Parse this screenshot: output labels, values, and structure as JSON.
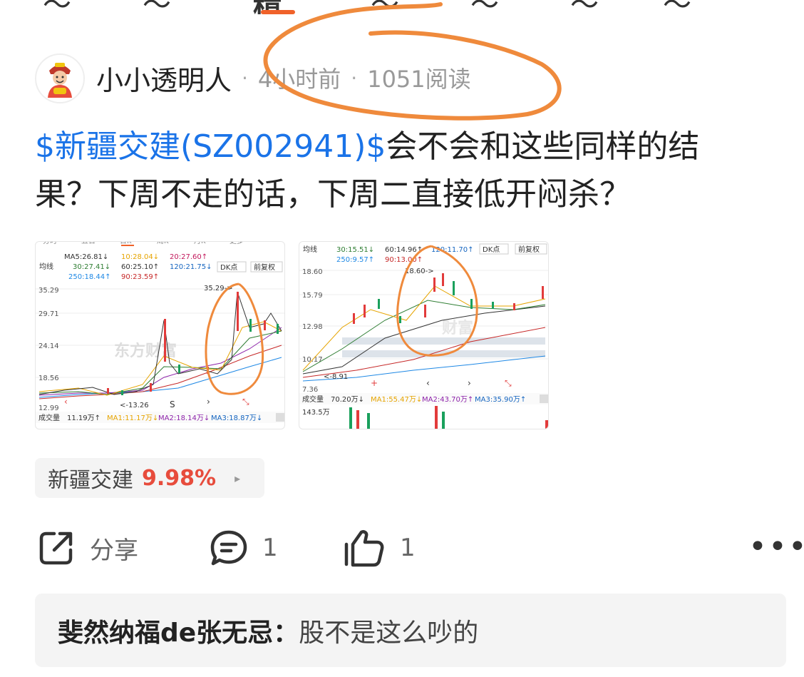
{
  "top_tabs": {
    "active_fragment": "精"
  },
  "post": {
    "author": "小小透明人",
    "time": "4小时前",
    "reads": "1051阅读",
    "separator": "·",
    "stock_link": "$新疆交建(SZ002941)$",
    "text_line1": "会不会和这些同样的结",
    "text_line2": "果？下周不走的话，下周二直接低开闷杀？"
  },
  "images": [
    {
      "tabs": [
        "分时",
        "五日",
        "日K",
        "周K",
        "月K",
        "更多"
      ],
      "ma_row1": [
        "MA5:26.81↓",
        "10:28.04↓",
        "20:27.60↑"
      ],
      "ma_row2": [
        "30:27.41↓",
        "60:25.10↑",
        "120:21.75↓"
      ],
      "ma_row3": [
        "250:18.44↑",
        "90:23.59↑"
      ],
      "selector": "均线",
      "dk_button": "DK点",
      "fq_button": "前复权",
      "y_labels": [
        "35.29",
        "29.71",
        "24.14",
        "18.56",
        "12.99"
      ],
      "peak_label": "35.29->",
      "low_label": "<-13.26",
      "s_marker": "S",
      "watermark": "东方财富",
      "volume_label": "成交量",
      "volume_values": [
        "11.19万↑",
        "MA1:11.17万↓",
        "MA2:18.14万↓",
        "MA3:18.87万↓"
      ],
      "colors": {
        "up": "#e23b3b",
        "down": "#1aa05c"
      }
    },
    {
      "selector": "均线",
      "ma_row1": [
        "30:15.51↓",
        "60:14.96↑",
        "120:11.70↑"
      ],
      "ma_row2": [
        "250:9.57↑",
        "90:13.00↑"
      ],
      "dk_button": "DK点",
      "fq_button": "前复权",
      "y_labels": [
        "18.60",
        "15.79",
        "12.98",
        "10.17",
        "7.36"
      ],
      "peak_label": "18.60->",
      "low_label": "<-8.91",
      "watermark": "财富",
      "volume_label": "成交量",
      "volume_values": [
        "70.20万↓",
        "MA1:55.47万↓",
        "MA2:43.70万↑",
        "MA3:35.90万↑"
      ],
      "volume_axis": "143.5万",
      "colors": {
        "up": "#e23b3b",
        "down": "#1aa05c"
      }
    }
  ],
  "stock_chip": {
    "name": "新疆交建",
    "change": "9.98%",
    "arrow": "▸"
  },
  "actions": {
    "share": "分享",
    "comments": "1",
    "likes": "1",
    "more": "•••"
  },
  "comment": {
    "author": "斐然纳福de张无忌",
    "colon": "：",
    "text": "股不是这么吵的"
  },
  "colors": {
    "link": "#1a73e8",
    "up": "#e74c3c",
    "annotation": "#ef8a3c"
  }
}
